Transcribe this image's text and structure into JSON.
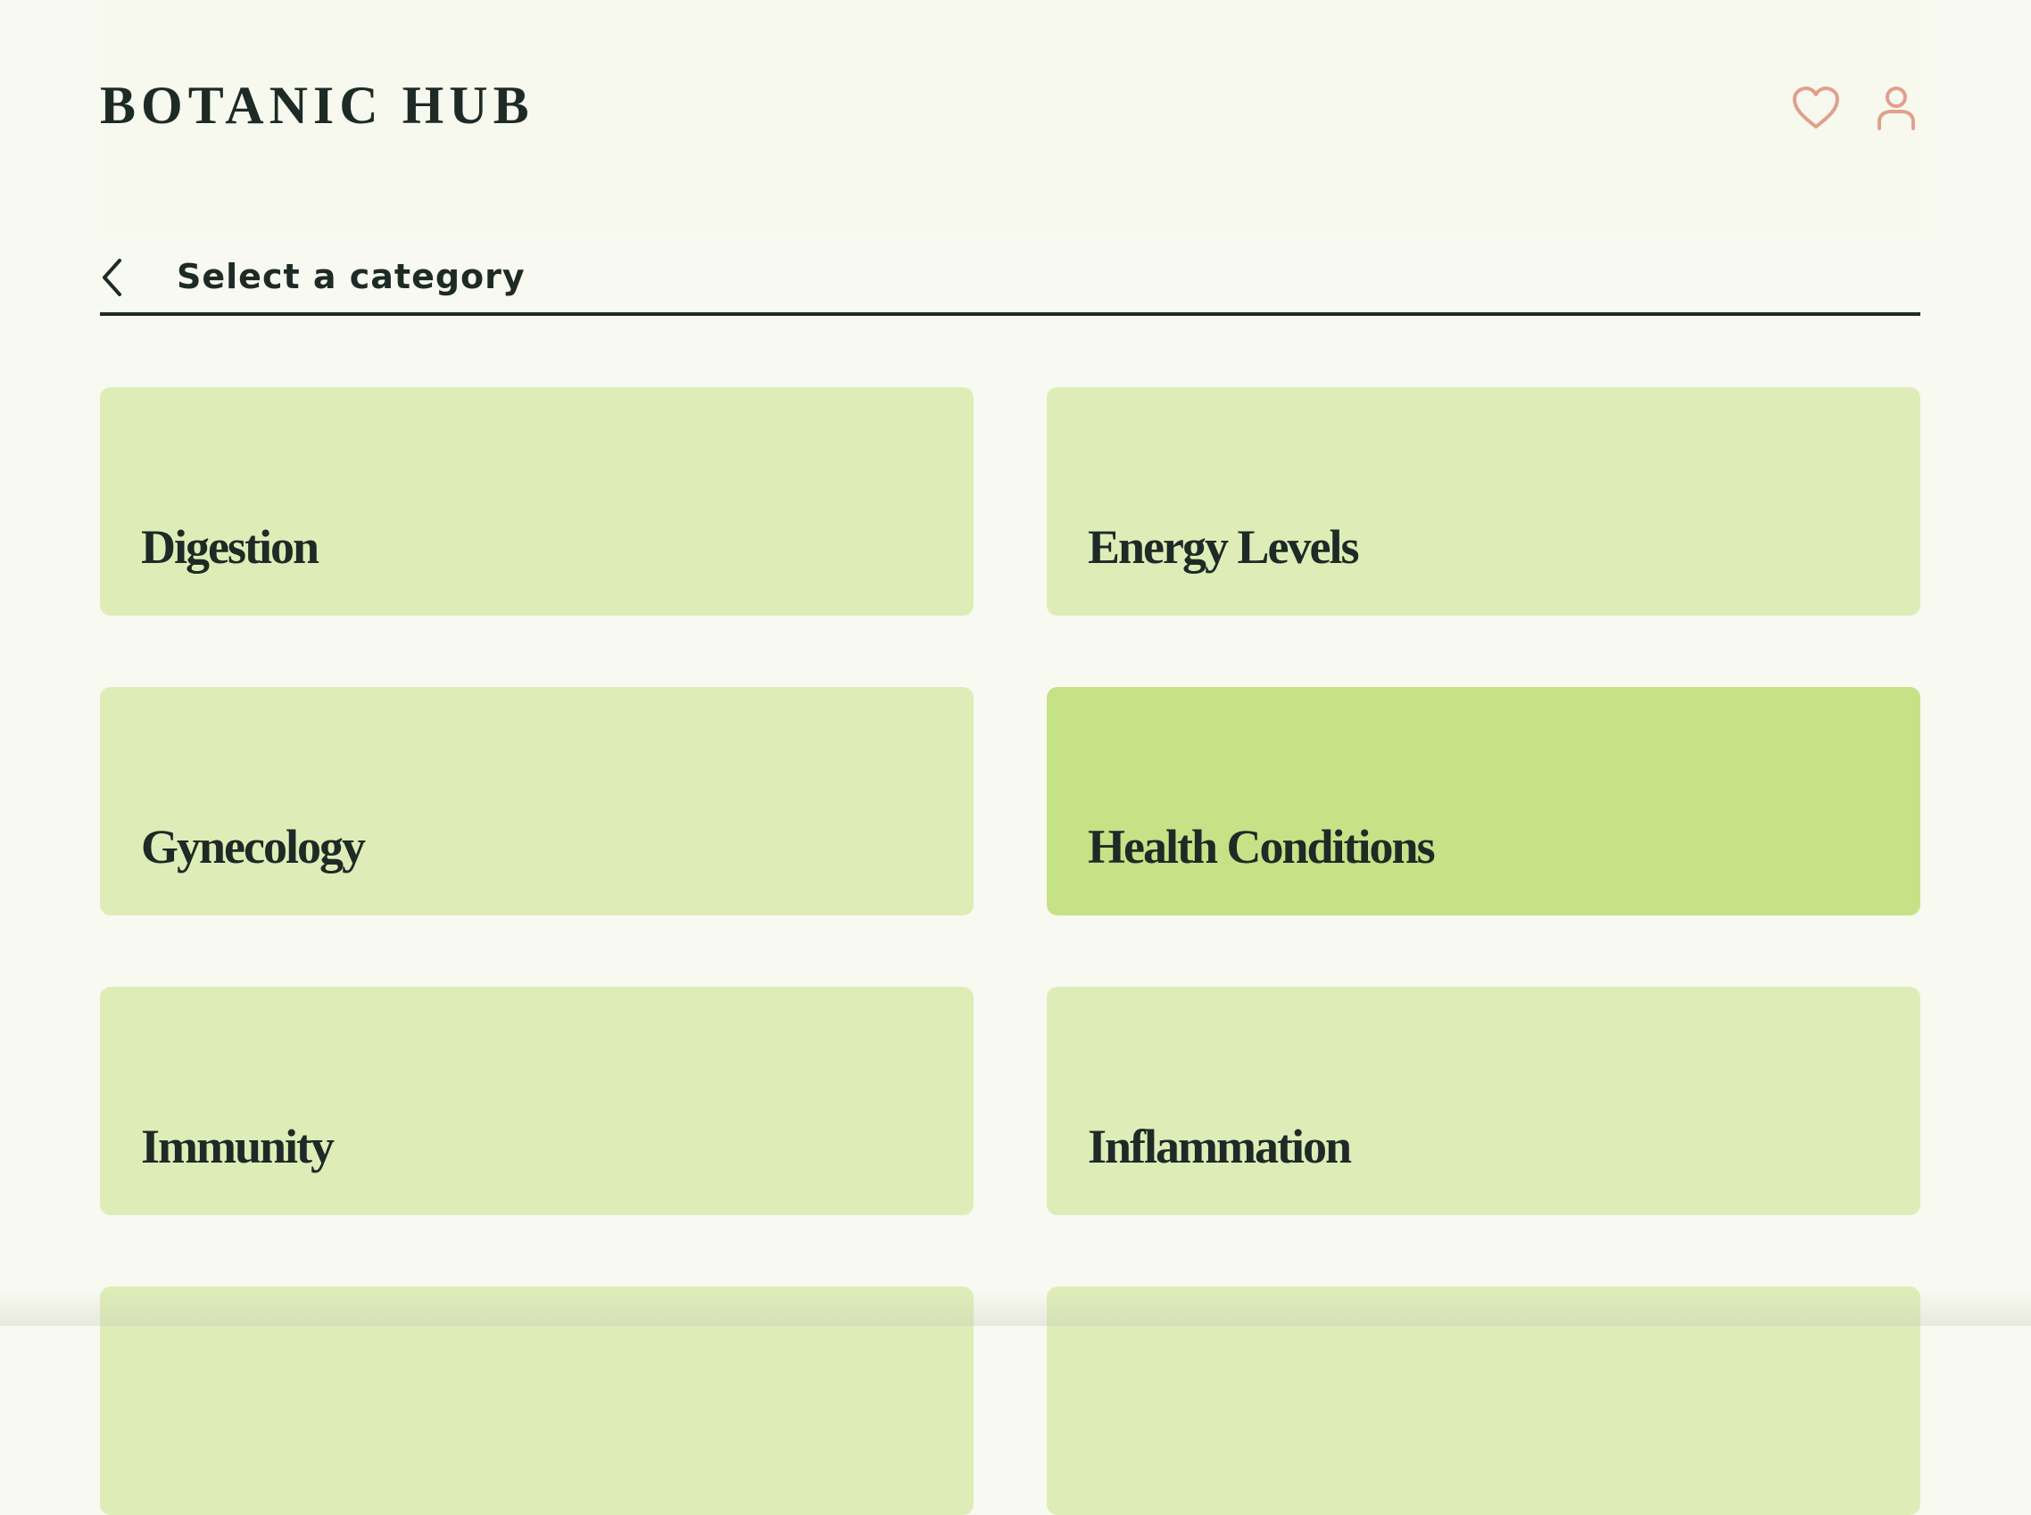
{
  "header": {
    "logo": "BOTANIC HUB",
    "icons": [
      {
        "name": "heart-icon",
        "label": "Favorites"
      },
      {
        "name": "user-icon",
        "label": "Account"
      }
    ]
  },
  "nav": {
    "title": "Select a category"
  },
  "categories": [
    {
      "label": "Digestion",
      "active": false
    },
    {
      "label": "Energy Levels",
      "active": false
    },
    {
      "label": "Gynecology",
      "active": false
    },
    {
      "label": "Health Conditions",
      "active": true
    },
    {
      "label": "Immunity",
      "active": false
    },
    {
      "label": "Inflammation",
      "active": false
    },
    {
      "label": "",
      "active": false
    },
    {
      "label": "",
      "active": false
    }
  ],
  "colors": {
    "background": "#f8f9f0",
    "card": "#deedb7",
    "card_active": "#c5e286",
    "text": "#1e2a26",
    "icon_accent": "#e0a08c"
  }
}
